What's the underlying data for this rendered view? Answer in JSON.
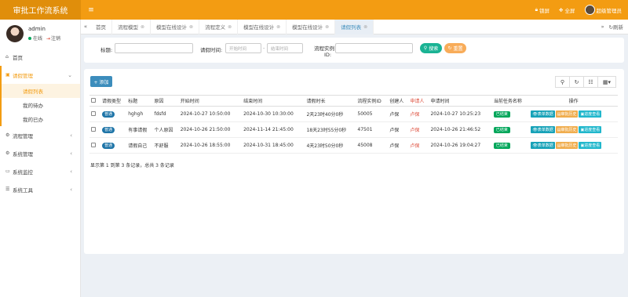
{
  "app": {
    "title": "审批工作流系统",
    "menu_icon": "hamburger-icon"
  },
  "topbar": {
    "lock": "锁屏",
    "fullscreen": "全屏",
    "user": "超级管理员"
  },
  "user": {
    "name": "admin",
    "online": "在线",
    "logout": "注销"
  },
  "sidebar": {
    "items": [
      {
        "label": "首页",
        "icon": "home-icon"
      },
      {
        "label": "请假管理",
        "icon": "folder-icon"
      },
      {
        "label": "流程管理",
        "icon": "cog-icon"
      },
      {
        "label": "系统管理",
        "icon": "gear-icon"
      },
      {
        "label": "系统监控",
        "icon": "monitor-icon"
      },
      {
        "label": "系统工具",
        "icon": "tool-icon"
      }
    ],
    "sub_items": [
      "请假列表",
      "我的待办",
      "我的已办"
    ]
  },
  "tabs": {
    "items": [
      "首页",
      "流程模型",
      "模型在线设计",
      "流程定义",
      "模型在线设计",
      "模型在线设计",
      "请假列表"
    ],
    "refresh": "刷新"
  },
  "search": {
    "title_label": "标题:",
    "time_label": "请假时间:",
    "start_placeholder": "开始时间",
    "end_placeholder": "结束时间",
    "dash": "-",
    "instance_label": "流程实例",
    "instance_label2": "ID:",
    "search_button": "搜索",
    "reset_button": "重置"
  },
  "toolbar": {
    "add_button": "+ 添加"
  },
  "table": {
    "headers": [
      "请假类型",
      "标题",
      "原因",
      "开始时间",
      "结束时间",
      "请假时长",
      "流程实例ID",
      "创建人",
      "申请人",
      "申请时间",
      "当前任务名称",
      "操作"
    ],
    "rows": [
      {
        "type": "普通",
        "title": "hghgh",
        "reason": "fdsfd",
        "start": "2024-10-27 10:50:00",
        "end": "2024-10-30 10:30:00",
        "duration": "2天23时40分0秒",
        "instance": "50005",
        "creator": "卢保",
        "applicant": "卢保",
        "apply_time": "2024-10-27 10:25:23",
        "task": "已结束"
      },
      {
        "type": "普通",
        "title": "有事请假",
        "reason": "个人原因",
        "start": "2024-10-26 21:50:00",
        "end": "2024-11-14 21:45:00",
        "duration": "18天23时55分0秒",
        "instance": "47501",
        "creator": "卢保",
        "applicant": "卢保",
        "apply_time": "2024-10-26 21:46:52",
        "task": "已结束"
      },
      {
        "type": "普通",
        "title": "请假自己",
        "reason": "不舒服",
        "start": "2024-10-26 18:55:00",
        "end": "2024-10-31 18:45:00",
        "duration": "4天23时50分0秒",
        "instance": "45008",
        "creator": "卢保",
        "applicant": "卢保",
        "apply_time": "2024-10-26 19:04:27",
        "task": "已结束"
      }
    ],
    "actions": [
      "表单数据",
      "审批历史",
      "进度查看"
    ]
  },
  "pager": "显示第 1 到第 3 条记录，总共 3 条记录",
  "colors": {
    "brand": "#f39c12",
    "primary": "#3c8dbc",
    "success": "#00a65a",
    "danger": "#dd4b39"
  }
}
